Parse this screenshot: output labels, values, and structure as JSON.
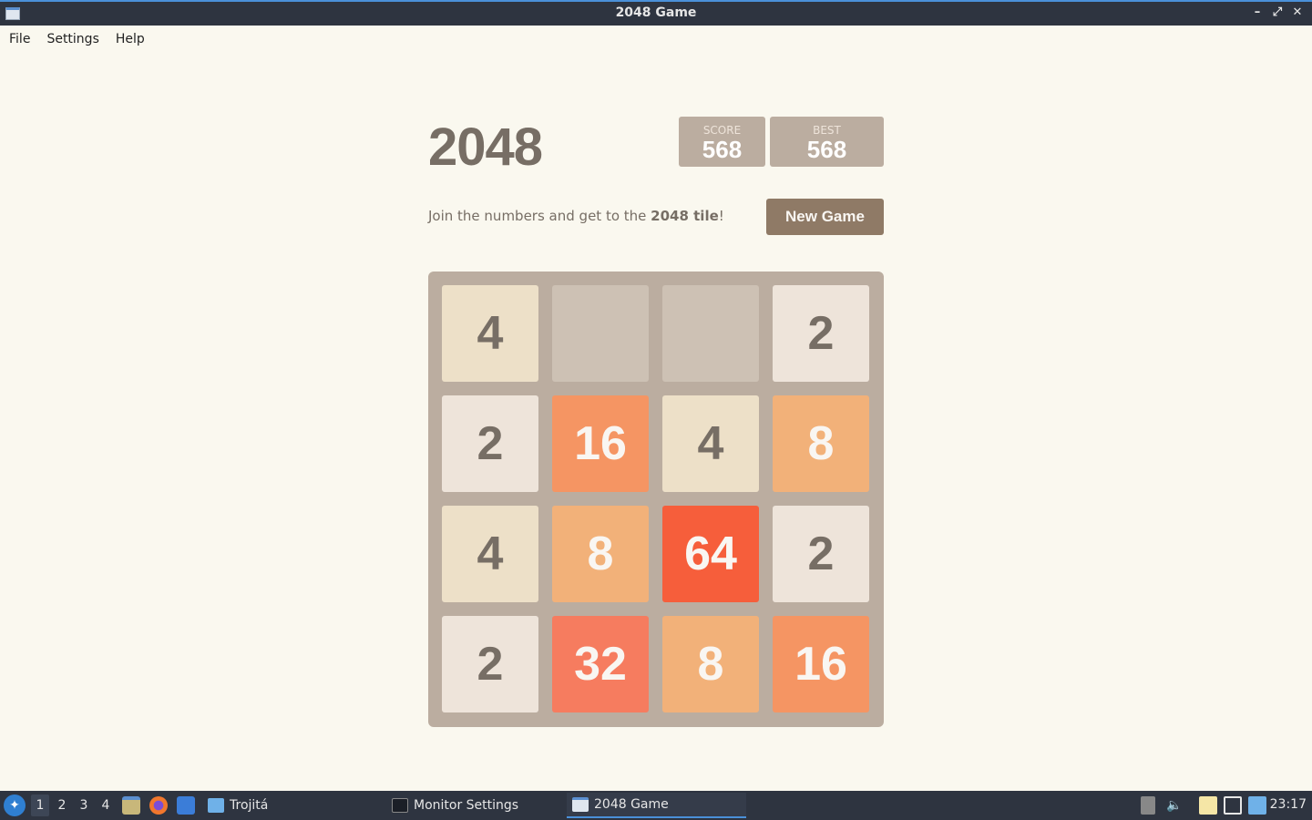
{
  "window": {
    "title": "2048 Game",
    "controls": {
      "minimize": "–",
      "maximize": "⤢",
      "close": "✕"
    }
  },
  "menubar": {
    "items": [
      "File",
      "Settings",
      "Help"
    ]
  },
  "game": {
    "heading": "2048",
    "score_label": "SCORE",
    "score": "568",
    "best_label": "BEST",
    "best": "568",
    "intro_prefix": "Join the numbers and get to the ",
    "intro_bold": "2048 tile",
    "intro_suffix": "!",
    "new_game_label": "New Game",
    "grid": [
      [
        4,
        null,
        null,
        2
      ],
      [
        2,
        16,
        4,
        8
      ],
      [
        4,
        8,
        64,
        2
      ],
      [
        2,
        32,
        8,
        16
      ]
    ],
    "tile_colors": {
      "2": {
        "bg": "#eee4da",
        "fg": "#776e65"
      },
      "4": {
        "bg": "#ede0c8",
        "fg": "#776e65"
      },
      "8": {
        "bg": "#f2b179",
        "fg": "#f9f6f2"
      },
      "16": {
        "bg": "#f59563",
        "fg": "#f9f6f2"
      },
      "32": {
        "bg": "#f67c5f",
        "fg": "#f9f6f2"
      },
      "64": {
        "bg": "#f65e3b",
        "fg": "#f9f6f2"
      }
    },
    "empty_cell_color": "#cdc1b4",
    "board_color": "#bbada0"
  },
  "taskbar": {
    "desktops": [
      "1",
      "2",
      "3",
      "4"
    ],
    "active_desktop": "1",
    "quicklaunch_icons": [
      "file-manager-icon",
      "firefox-icon",
      "desktop-icon"
    ],
    "tasks": [
      {
        "label": "Trojitá",
        "icon": "mail-icon"
      },
      {
        "label": "Monitor Settings",
        "icon": "monitor-icon"
      },
      {
        "label": "2048 Game",
        "icon": "window-icon"
      }
    ],
    "active_task": "2048 Game",
    "tray_icons": [
      "removable-drive-icon",
      "volume-icon",
      "clipboard-icon",
      "screen-icon",
      "mail-notify-icon"
    ],
    "clock": "23:17"
  }
}
